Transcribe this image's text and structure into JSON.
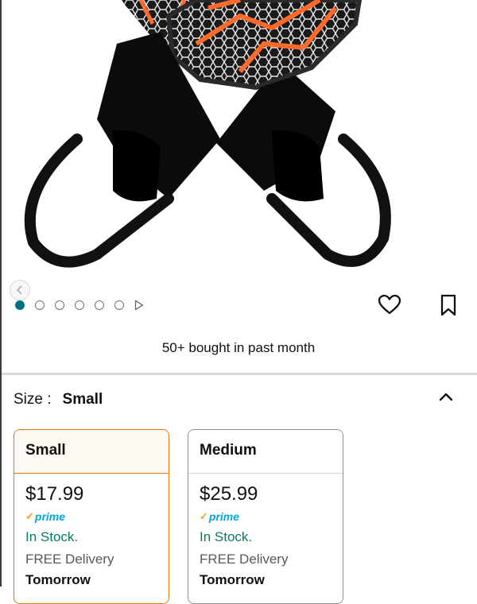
{
  "product": {
    "bought_text": "50+ bought in past month"
  },
  "gallery": {
    "total_images": 6,
    "active_index": 0,
    "has_video": true
  },
  "size_selector": {
    "label": "Size :",
    "selected": "Small"
  },
  "options": [
    {
      "name": "Small",
      "price": "$17.99",
      "prime": "prime",
      "stock": "In Stock.",
      "delivery": "FREE Delivery",
      "delivery_date": "Tomorrow"
    },
    {
      "name": "Medium",
      "price": "$25.99",
      "prime": "prime",
      "stock": "In Stock.",
      "delivery": "FREE Delivery",
      "delivery_date": "Tomorrow"
    }
  ],
  "colors": {
    "accent_teal": "#007185",
    "selected_border": "#e47911",
    "stock_green": "#067d62",
    "prime_blue": "#00a8e1"
  }
}
